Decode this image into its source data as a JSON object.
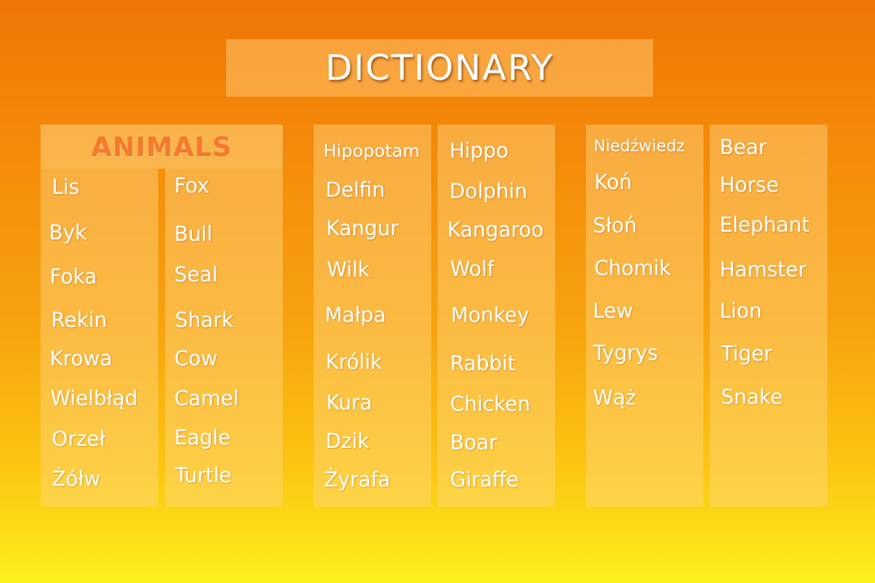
{
  "title": "DICTIONARY",
  "section_header": "ANIMALS",
  "colors": {
    "header_text": "#f47a2c",
    "word_text": "#ffffff",
    "background_top": "#ef7504",
    "background_bottom": "#fdf01a"
  },
  "group1": {
    "polish": [
      "Lis",
      "Byk",
      "Foka",
      "Rekin",
      "Krowa",
      "Wielbłąd",
      "Orzeł",
      "Żółw"
    ],
    "english": [
      "Fox",
      "Bull",
      "Seal",
      "Shark",
      "Cow",
      "Camel",
      "Eagle",
      "Turtle"
    ]
  },
  "group2": {
    "polish": [
      "Hipopotam",
      "Delfin",
      "Kangur",
      "Wilk",
      "Małpa",
      "Królik",
      "Kura",
      "Dzik",
      "Żyrafa"
    ],
    "english": [
      "Hippo",
      "Dolphin",
      "Kangaroo",
      "Wolf",
      "Monkey",
      "Rabbit",
      "Chicken",
      "Boar",
      "Giraffe"
    ]
  },
  "group3": {
    "polish": [
      "Niedźwiedz",
      "Koń",
      "Słoń",
      "Chomik",
      "Lew",
      "Tygrys",
      "Wąż"
    ],
    "english": [
      "Bear",
      "Horse",
      "Elephant",
      "Hamster",
      "Lion",
      "Tiger",
      "Snake"
    ]
  }
}
